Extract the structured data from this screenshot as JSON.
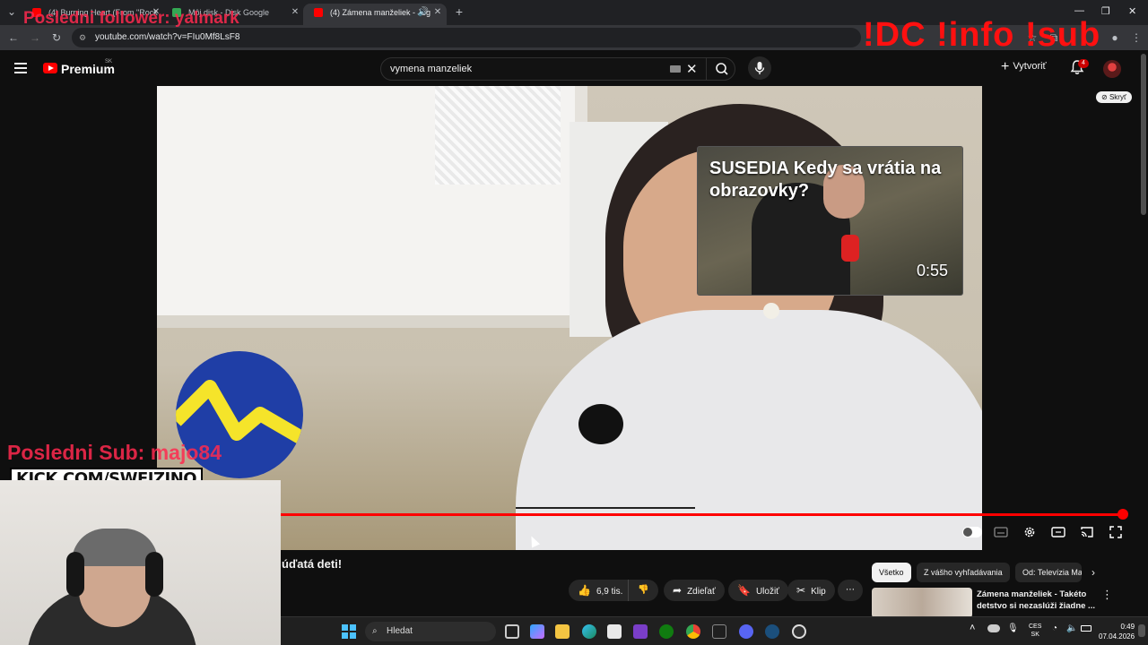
{
  "browser": {
    "tabs": [
      {
        "title": "(4) Burning Heart (From \"Rock",
        "favicon_color": "#ff0000"
      },
      {
        "title": "Môj disk - Disk Google",
        "favicon_color": "#34a853"
      },
      {
        "title": "(4) Zámena manželiek - Jeg",
        "favicon_color": "#ff0000",
        "active": true
      }
    ],
    "url": "youtube.com/watch?v=FIu0Mf8LsF8"
  },
  "youtube": {
    "brand": "Premium",
    "region": "SK",
    "search_value": "vymena manzeliek",
    "create_label": "Vytvoriť",
    "notifications_count": "4"
  },
  "player": {
    "hide_label": "Skryť",
    "progress_fraction": 0.99,
    "end_card": {
      "title": "SUSEDIA Kedy sa vrátia na obrazovky?",
      "duration": "0:55"
    }
  },
  "overlays": {
    "follower_text": "Posledni follower: yalmark",
    "commands_text": "!DC !info !sub",
    "last_sub_text": "Posledni Sub: majo84",
    "kick_text": "KICK.COM/SWEJZINO"
  },
  "below_video": {
    "title_fragment": "úďatá deti!",
    "like_count": "6,9 tis.",
    "share_label": "Zdieľať",
    "save_label": "Uložiť",
    "clip_label": "Klip"
  },
  "chips": [
    "Všetko",
    "Z vášho vyhľadávania",
    "Od: Televízia Ma"
  ],
  "recommendation": {
    "title": "Zámena manželiek - Takéto detstvo si nezaslúži žiadne ..."
  },
  "taskbar": {
    "search_placeholder": "Hledat",
    "lang_line1": "CES",
    "lang_line2": "SK",
    "time": "0:49",
    "date": "07.04.2026"
  },
  "colors": {
    "yt_red": "#ff0000",
    "overlay_pink": "#ff2a4f",
    "stv_blue": "#1f3ea6",
    "stv_yellow": "#f5e42a"
  }
}
